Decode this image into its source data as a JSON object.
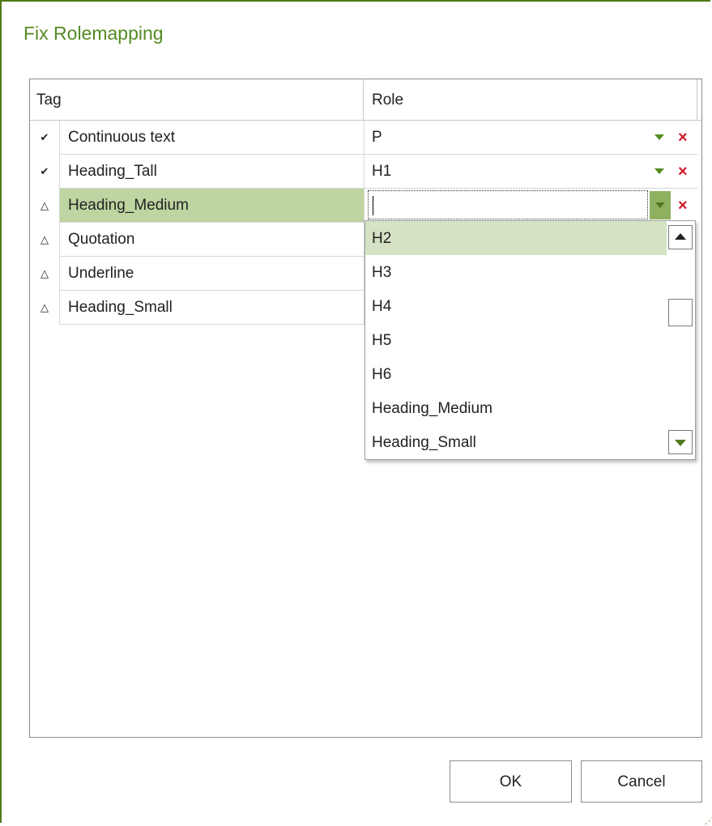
{
  "dialog": {
    "title": "Fix Rolemapping"
  },
  "grid": {
    "columns": {
      "tag": "Tag",
      "role": "Role"
    },
    "rows": [
      {
        "status_icon": "✔",
        "tag": "Continuous text",
        "role": "P"
      },
      {
        "status_icon": "⚠",
        "tag": "Heading_Tall",
        "role": "H1"
      },
      {
        "status_icon": "△",
        "tag": "Heading_Medium",
        "role": ""
      },
      {
        "status_icon": "△",
        "tag": "Quotation",
        "role": ""
      },
      {
        "status_icon": "△",
        "tag": "Underline",
        "role": ""
      },
      {
        "status_icon": "△",
        "tag": "Heading_Small",
        "role": ""
      }
    ],
    "delete_glyph": "×"
  },
  "dropdown": {
    "options": [
      "H2",
      "H3",
      "H4",
      "H5",
      "H6",
      "Heading_Medium",
      "Heading_Small"
    ],
    "selected": "H2"
  },
  "buttons": {
    "ok": "OK",
    "cancel": "Cancel"
  },
  "colors": {
    "accent": "#548b22",
    "selection": "#bed4a1",
    "delete": "#d01b2a"
  },
  "grip_glyph": "⋰"
}
